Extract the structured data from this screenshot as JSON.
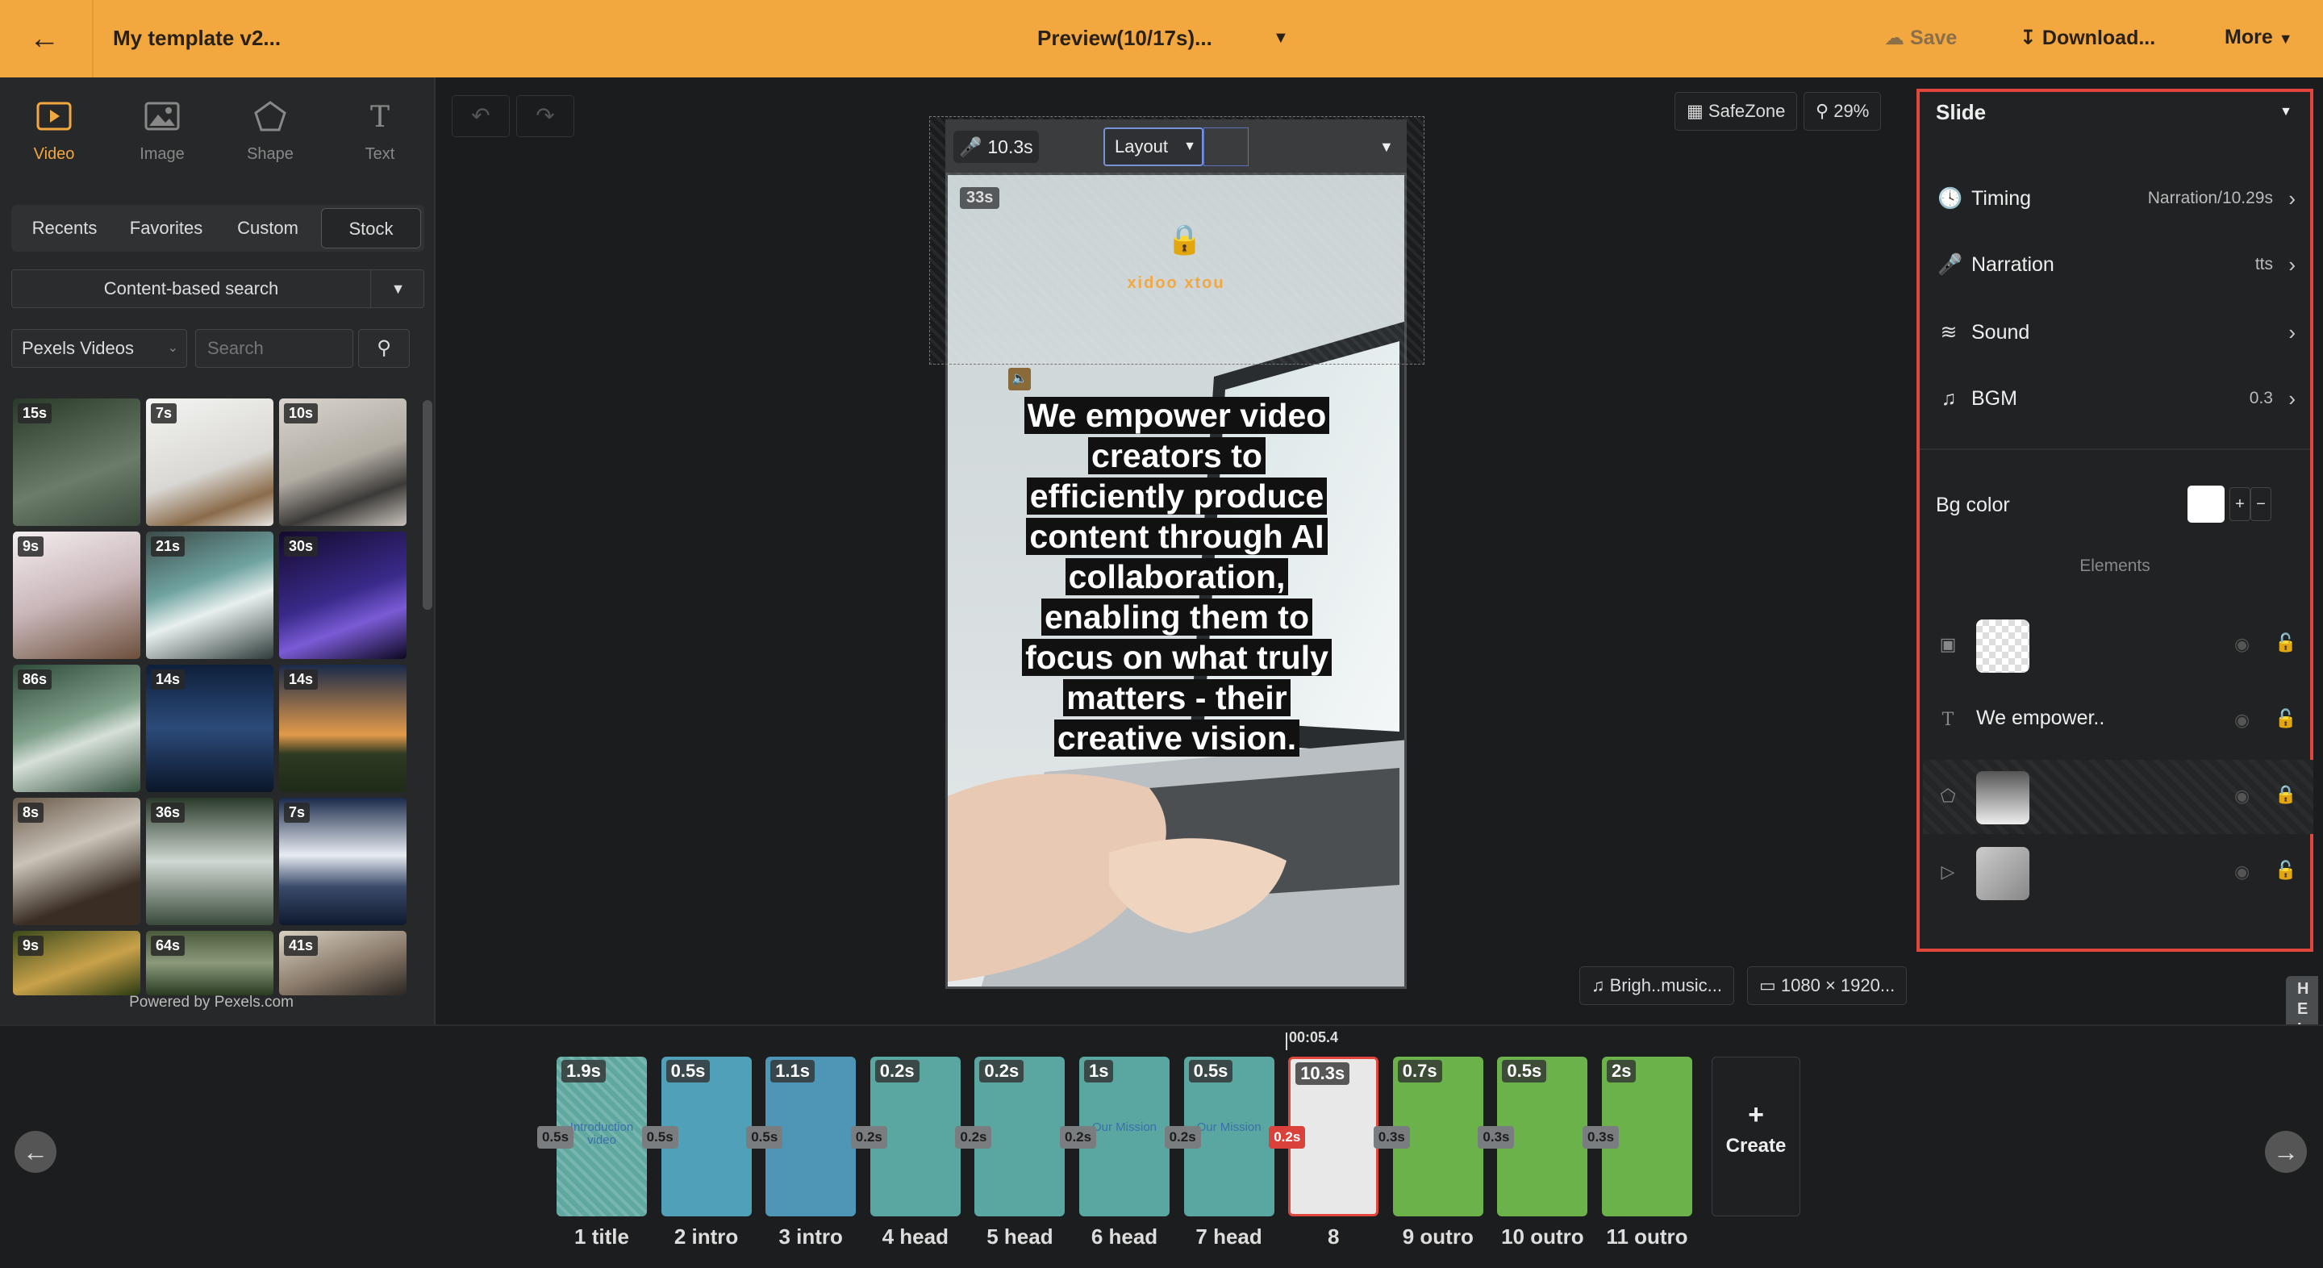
{
  "topbar": {
    "title": "My template v2...",
    "preview": "Preview(10/17s)...",
    "save": "Save",
    "download": "Download...",
    "more": "More"
  },
  "left": {
    "tabs": [
      {
        "label": "Video",
        "icon": "video-icon"
      },
      {
        "label": "Image",
        "icon": "image-icon"
      },
      {
        "label": "Shape",
        "icon": "pentagon-icon"
      },
      {
        "label": "Text",
        "icon": "text-icon"
      }
    ],
    "segments": [
      "Recents",
      "Favorites",
      "Custom",
      "Stock"
    ],
    "content_search": "Content-based search",
    "source": "Pexels Videos",
    "search_placeholder": "Search",
    "thumbs": [
      "15s",
      "7s",
      "10s",
      "9s",
      "21s",
      "30s",
      "86s",
      "14s",
      "14s",
      "8s",
      "36s",
      "7s",
      "9s",
      "64s",
      "41s"
    ],
    "powered": "Powered by Pexels.com"
  },
  "canvas": {
    "safezone": "SafeZone",
    "zoom": "29%",
    "narration_time": "10.3s",
    "layout": "Layout",
    "element_duration": "33s",
    "logo_text": "xidoo xtou",
    "headline": "We empower video creators to efficiently produce content through AI collaboration, enabling them to focus on what truly matters - their creative vision.",
    "music": "Brigh..music...",
    "resolution": "1080 × 1920..."
  },
  "right": {
    "title": "Slide",
    "timing": {
      "label": "Timing",
      "value": "Narration/10.29s"
    },
    "narration": {
      "label": "Narration",
      "value": "tts"
    },
    "sound": {
      "label": "Sound"
    },
    "bgm": {
      "label": "BGM",
      "value": "0.3"
    },
    "bgcolor": {
      "label": "Bg color",
      "value": "#ffffff"
    },
    "elements_title": "Elements",
    "elements": [
      {
        "type": "image",
        "label": ""
      },
      {
        "type": "text",
        "label": "We empower.."
      },
      {
        "type": "shape",
        "label": ""
      },
      {
        "type": "video",
        "label": ""
      }
    ]
  },
  "help": "HELP",
  "timeline": {
    "cursor_time": "00:05.4",
    "create": "Create",
    "slides": [
      {
        "label": "1 title",
        "dur": "1.9s"
      },
      {
        "label": "2 intro",
        "dur": "0.5s"
      },
      {
        "label": "3 intro",
        "dur": "1.1s"
      },
      {
        "label": "4 head",
        "dur": "0.2s"
      },
      {
        "label": "5 head",
        "dur": "0.2s"
      },
      {
        "label": "6 head",
        "dur": "1s"
      },
      {
        "label": "7 head",
        "dur": "0.5s"
      },
      {
        "label": "8",
        "dur": "10.3s"
      },
      {
        "label": "9 outro",
        "dur": "0.7s"
      },
      {
        "label": "10 outro",
        "dur": "0.5s"
      },
      {
        "label": "11 outro",
        "dur": "2s"
      }
    ],
    "transitions": [
      "0.5s",
      "0.5s",
      "0.5s",
      "0.2s",
      "0.2s",
      "0.2s",
      "0.2s",
      "0.2s",
      "0.3s",
      "0.3s",
      "0.3s"
    ],
    "slide_texts": {
      "s1": "Introduction video",
      "s6": "Our Mission",
      "s7": "Our Mission"
    }
  },
  "colors": {
    "accent": "#f3a73f",
    "highlight": "#e0463a",
    "selected_transition": "#d9413a"
  }
}
